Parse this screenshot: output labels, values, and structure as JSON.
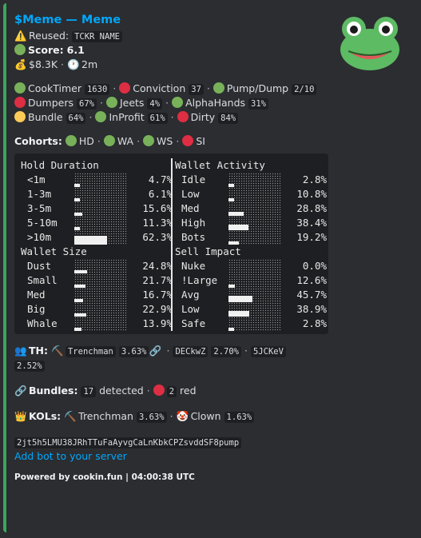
{
  "title": "$Meme — Meme",
  "reused": {
    "label": "Reused:",
    "ticker": "TCKR NAME"
  },
  "score": {
    "label": "Score:",
    "value": "6.1"
  },
  "mcap": "$8.3K",
  "age": "2m",
  "metrics": [
    [
      {
        "name": "CookTimer",
        "value": "1630",
        "color": "g"
      },
      {
        "name": "Conviction",
        "value": "37",
        "color": "r"
      },
      {
        "name": "Pump/Dump",
        "value": "2/10",
        "color": "g"
      }
    ],
    [
      {
        "name": "Dumpers",
        "value": "67%",
        "color": "r"
      },
      {
        "name": "Jeets",
        "value": "4%",
        "color": "g"
      },
      {
        "name": "AlphaHands",
        "value": "31%",
        "color": "g"
      }
    ],
    [
      {
        "name": "Bundle",
        "value": "64%",
        "color": "y"
      },
      {
        "name": "InProfit",
        "value": "61%",
        "color": "g"
      },
      {
        "name": "Dirty",
        "value": "84%",
        "color": "r"
      }
    ]
  ],
  "cohorts": {
    "label": "Cohorts:",
    "items": [
      {
        "name": "HD",
        "color": "g"
      },
      {
        "name": "WA",
        "color": "g"
      },
      {
        "name": "WS",
        "color": "g"
      },
      {
        "name": "SI",
        "color": "r"
      }
    ]
  },
  "table": {
    "left": [
      {
        "header": "Hold Duration",
        "rows": [
          {
            "label": "<1m",
            "pct": "4.7%",
            "v": 4.7
          },
          {
            "label": "1-3m",
            "pct": "6.1%",
            "v": 6.1
          },
          {
            "label": "3-5m",
            "pct": "15.6%",
            "v": 15.6
          },
          {
            "label": "5-10m",
            "pct": "11.3%",
            "v": 11.3
          },
          {
            "label": ">10m",
            "pct": "62.3%",
            "v": 62.3
          }
        ]
      },
      {
        "header": "Wallet Size",
        "rows": [
          {
            "label": "Dust",
            "pct": "24.8%",
            "v": 24.8
          },
          {
            "label": "Small",
            "pct": "21.7%",
            "v": 21.7
          },
          {
            "label": "Med",
            "pct": "16.7%",
            "v": 16.7
          },
          {
            "label": "Big",
            "pct": "22.9%",
            "v": 22.9
          },
          {
            "label": "Whale",
            "pct": "13.9%",
            "v": 13.9
          }
        ]
      }
    ],
    "right": [
      {
        "header": "Wallet Activity",
        "rows": [
          {
            "label": "Idle",
            "pct": "2.8%",
            "v": 2.8
          },
          {
            "label": "Low",
            "pct": "10.8%",
            "v": 10.8
          },
          {
            "label": "Med",
            "pct": "28.8%",
            "v": 28.8
          },
          {
            "label": "High",
            "pct": "38.4%",
            "v": 38.4
          },
          {
            "label": "Bots",
            "pct": "19.2%",
            "v": 19.2
          }
        ]
      },
      {
        "header": "Sell Impact",
        "rows": [
          {
            "label": "Nuke",
            "pct": "0.0%",
            "v": 0.0
          },
          {
            "label": "!Large",
            "pct": "12.6%",
            "v": 12.6
          },
          {
            "label": "Avg",
            "pct": "45.7%",
            "v": 45.7
          },
          {
            "label": "Low",
            "pct": "38.9%",
            "v": 38.9
          },
          {
            "label": "Safe",
            "pct": "2.8%",
            "v": 2.8
          }
        ]
      }
    ]
  },
  "th": {
    "label": "TH:",
    "items": [
      {
        "name": "Trenchman",
        "value": "3.63%"
      },
      {
        "name": "DECkwZ",
        "value": "2.70%"
      },
      {
        "name": "5JCKeV",
        "value": "2.52%"
      }
    ]
  },
  "bundles": {
    "label": "Bundles:",
    "detected": "17",
    "detected_text": "detected",
    "red": "2",
    "red_text": "red"
  },
  "kols": {
    "label": "KOLs:",
    "items": [
      {
        "name": "Trenchman",
        "value": "3.63%"
      },
      {
        "name": "Clown",
        "value": "1.63%"
      }
    ]
  },
  "address": "2jt5h5LMU38JRhTTuFaAyvgCaLnKbkCPZsvddSF8pump",
  "add_bot": "Add bot to your server",
  "footer": "Powered by cookin.fun | 04:00:38 UTC",
  "colors": {
    "stripe": "#3ba55c",
    "link": "#00a8fc",
    "green": "#78b159",
    "red": "#dd2e44",
    "yellow": "#fdcb58"
  }
}
